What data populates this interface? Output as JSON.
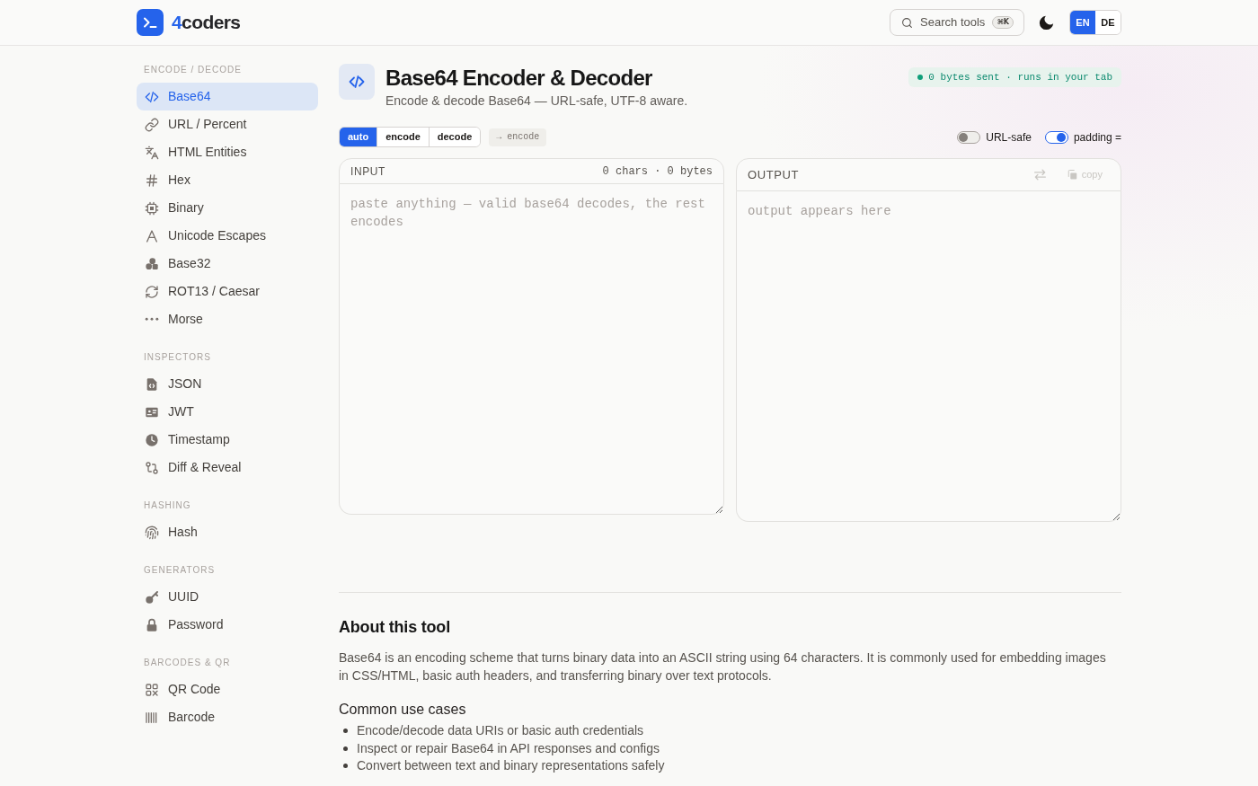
{
  "header": {
    "brand": {
      "accent": "4",
      "name": "coders"
    },
    "search": {
      "label": "Search tools",
      "shortcut": "⌘K"
    },
    "languages": [
      {
        "label": "EN",
        "selected": true
      },
      {
        "label": "DE",
        "selected": false
      }
    ]
  },
  "sidebar": {
    "sections": [
      {
        "title": "ENCODE / DECODE",
        "items": [
          {
            "label": "Base64",
            "selected": true
          },
          {
            "label": "URL / Percent",
            "selected": false
          },
          {
            "label": "HTML Entities",
            "selected": false
          },
          {
            "label": "Hex",
            "selected": false
          },
          {
            "label": "Binary",
            "selected": false
          },
          {
            "label": "Unicode Escapes",
            "selected": false
          },
          {
            "label": "Base32",
            "selected": false
          },
          {
            "label": "ROT13 / Caesar",
            "selected": false
          },
          {
            "label": "Morse",
            "selected": false
          }
        ]
      },
      {
        "title": "INSPECTORS",
        "items": [
          {
            "label": "JSON",
            "selected": false
          },
          {
            "label": "JWT",
            "selected": false
          },
          {
            "label": "Timestamp",
            "selected": false
          },
          {
            "label": "Diff & Reveal",
            "selected": false
          }
        ]
      },
      {
        "title": "HASHING",
        "items": [
          {
            "label": "Hash",
            "selected": false
          }
        ]
      },
      {
        "title": "GENERATORS",
        "items": [
          {
            "label": "UUID",
            "selected": false
          },
          {
            "label": "Password",
            "selected": false
          }
        ]
      },
      {
        "title": "BARCODES & QR",
        "items": [
          {
            "label": "QR Code",
            "selected": false
          },
          {
            "label": "Barcode",
            "selected": false
          }
        ]
      }
    ]
  },
  "tool": {
    "title": "Base64 Encoder & Decoder",
    "subtitle": "Encode & decode Base64 — URL-safe, UTF-8 aware.",
    "privacy_badge": "0 bytes sent · runs in your tab",
    "modes": [
      {
        "label": "auto",
        "selected": true
      },
      {
        "label": "encode",
        "selected": false
      },
      {
        "label": "decode",
        "selected": false
      }
    ],
    "detected_mode": "→ encode",
    "options": [
      {
        "label": "URL-safe",
        "on": false
      },
      {
        "label": "padding =",
        "on": true
      }
    ]
  },
  "input": {
    "title": "INPUT",
    "stats": "0 chars · 0 bytes",
    "placeholder": "paste anything — valid base64 decodes, the rest encodes"
  },
  "output": {
    "title": "OUTPUT",
    "swap_button": {
      "disabled": true
    },
    "copy_button": {
      "label": "copy",
      "disabled": true
    },
    "placeholder": "output appears here"
  },
  "about": {
    "title": "About this tool",
    "text": "Base64 is an encoding scheme that turns binary data into an ASCII string using 64 characters. It is commonly used for embedding images in CSS/HTML, basic auth headers, and transferring binary over text protocols.",
    "use_cases_title": "Common use cases",
    "use_cases": [
      "Encode/decode data URIs or basic auth credentials",
      "Inspect or repair Base64 in API responses and configs",
      "Convert between text and binary representations safely"
    ]
  }
}
